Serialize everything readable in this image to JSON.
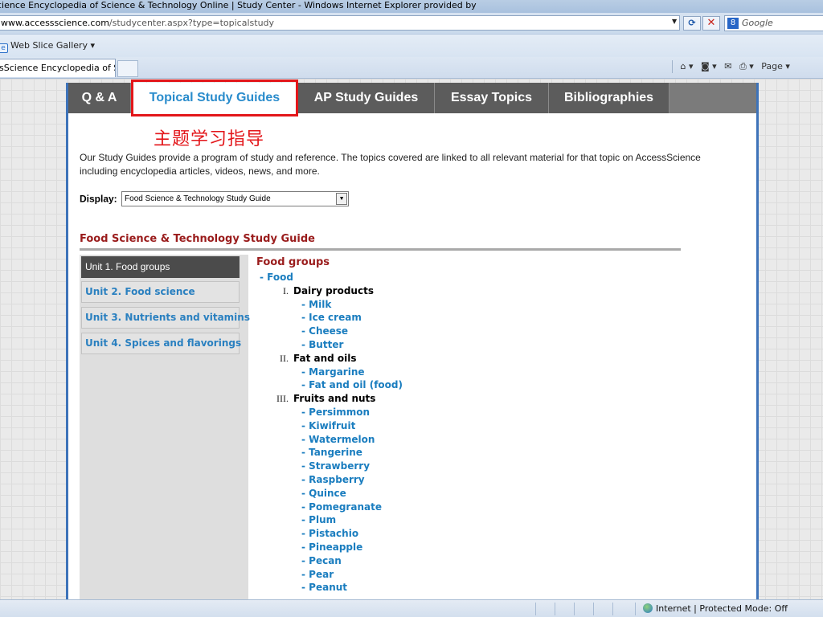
{
  "browser": {
    "title": "cience Encyclopedia of Science & Technology Online | Study Center - Windows Internet Explorer provided by",
    "address_domain": "www.accessscience.com",
    "address_path": "/studycenter.aspx?type=topicalstudy",
    "refresh_icon": "refresh-icon",
    "stop_icon": "stop-icon",
    "search_placeholder": "Google",
    "favorites_item": "Web Slice Gallery ▾",
    "tab_title": "sScience Encyclopedia of Sci...",
    "cmd_page": "Page ▾",
    "status_text": "Internet | Protected Mode: Off"
  },
  "nav": {
    "tabs": [
      {
        "label": "Q & A"
      },
      {
        "label": "Topical Study Guides"
      },
      {
        "label": "AP Study Guides"
      },
      {
        "label": "Essay Topics"
      },
      {
        "label": "Bibliographies"
      }
    ]
  },
  "annotation": {
    "text": "主题学习指导",
    "color": "#e3161a"
  },
  "intro": {
    "text": "Our Study Guides provide a program of study and reference. The topics covered are linked to all relevant material for that topic on AccessScience including encyclopedia articles, videos, news, and more."
  },
  "display": {
    "label": "Display:",
    "selected": "Food Science & Technology Study Guide"
  },
  "guide": {
    "title": "Food Science & Technology Study Guide",
    "units": [
      {
        "label": "Unit 1. Food groups"
      },
      {
        "label": "Unit 2. Food science"
      },
      {
        "label": "Unit 3. Nutrients and vitamins"
      },
      {
        "label": "Unit 4. Spices and flavorings"
      }
    ],
    "section_title": "Food groups",
    "root": "- Food",
    "categories": [
      {
        "numeral": "I.",
        "name": "Dairy products",
        "items": [
          "- Milk",
          "- Ice cream",
          "- Cheese",
          "- Butter"
        ]
      },
      {
        "numeral": "II.",
        "name": "Fat and oils",
        "items": [
          "- Margarine",
          "- Fat and oil (food)"
        ]
      },
      {
        "numeral": "III.",
        "name": "Fruits and nuts",
        "items": [
          "- Persimmon",
          "- Kiwifruit",
          "- Watermelon",
          "- Tangerine",
          "- Strawberry",
          "- Raspberry",
          "- Quince",
          "- Pomegranate",
          "- Plum",
          "- Pistachio",
          "- Pineapple",
          "- Pecan",
          "- Pear",
          "- Peanut"
        ]
      }
    ]
  },
  "colors": {
    "accent_link": "#1a7dbf",
    "heading_red": "#9a1c1c",
    "nav_bg": "#5c5c5c",
    "frame_blue": "#3e73b9"
  }
}
